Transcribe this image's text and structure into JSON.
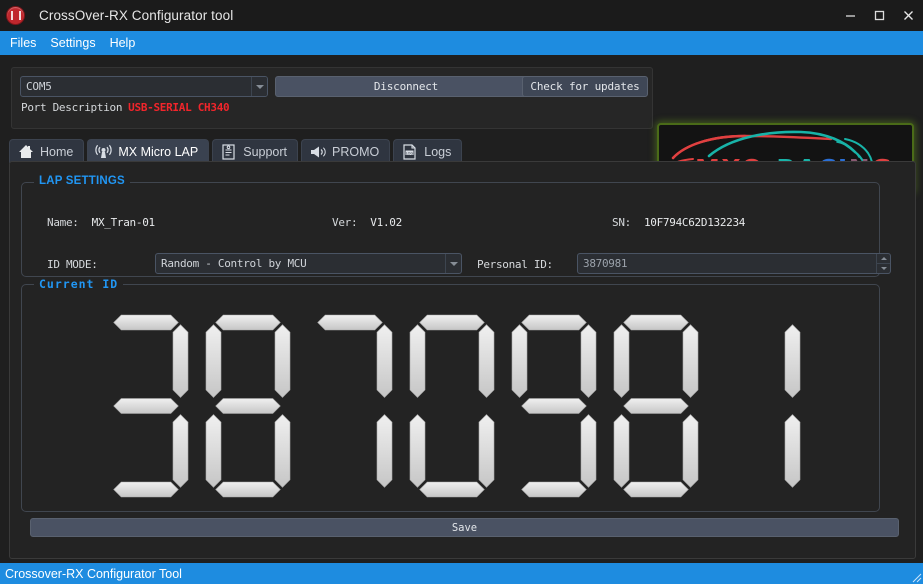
{
  "window": {
    "title": "CrossOver-RX Configurator tool",
    "app_icon": "lap-timer-icon",
    "controls": {
      "minimize": "minimize-icon",
      "maximize": "maximize-icon",
      "close": "close-icon"
    }
  },
  "menubar": {
    "items": [
      {
        "label": "Files"
      },
      {
        "label": "Settings"
      },
      {
        "label": "Help"
      }
    ]
  },
  "connection": {
    "port_select": {
      "value": "COM5",
      "icon": "chevron-down-icon"
    },
    "disconnect_label": "Disconnect",
    "check_updates_label": "Check for updates",
    "port_description_label": "Port Description",
    "port_description_value": "USB-SERIAL CH340",
    "port_description_color": "#f2252b"
  },
  "logo": {
    "text": "MXO-RACING",
    "alt": "mxo-racing-logo",
    "colors": {
      "teal": "#18b3a8",
      "red": "#e04040",
      "blue": "#2a6fd6",
      "border": "#4a6b18"
    }
  },
  "tabs": [
    {
      "label": "Home",
      "icon": "home-icon",
      "active": false
    },
    {
      "label": "MX Micro LAP",
      "icon": "antenna-icon",
      "active": true
    },
    {
      "label": "Support",
      "icon": "document-icon",
      "active": false
    },
    {
      "label": "PROMO",
      "icon": "megaphone-icon",
      "active": false
    },
    {
      "label": "Logs",
      "icon": "log-file-icon",
      "active": false
    }
  ],
  "lap_settings": {
    "title": "LAP SETTINGS",
    "name_label": "Name:",
    "name_value": "MX_Tran-01",
    "ver_label": "Ver:",
    "ver_value": "V1.02",
    "sn_label": "SN:",
    "sn_value": "10F794C62D132234",
    "id_mode_label": "ID MODE:",
    "id_mode_value": "Random - Control by MCU",
    "personal_id_label": "Personal ID:",
    "personal_id_value": "3870981"
  },
  "current_id": {
    "title": "Current ID",
    "digits": [
      "3",
      "8",
      "7",
      "0",
      "9",
      "8",
      "1"
    ],
    "value": "3870981",
    "segment_color": "#dcdcdc"
  },
  "footer": {
    "save_label": "Save"
  },
  "statusbar": {
    "text": "Crossover-RX Configurator Tool"
  }
}
